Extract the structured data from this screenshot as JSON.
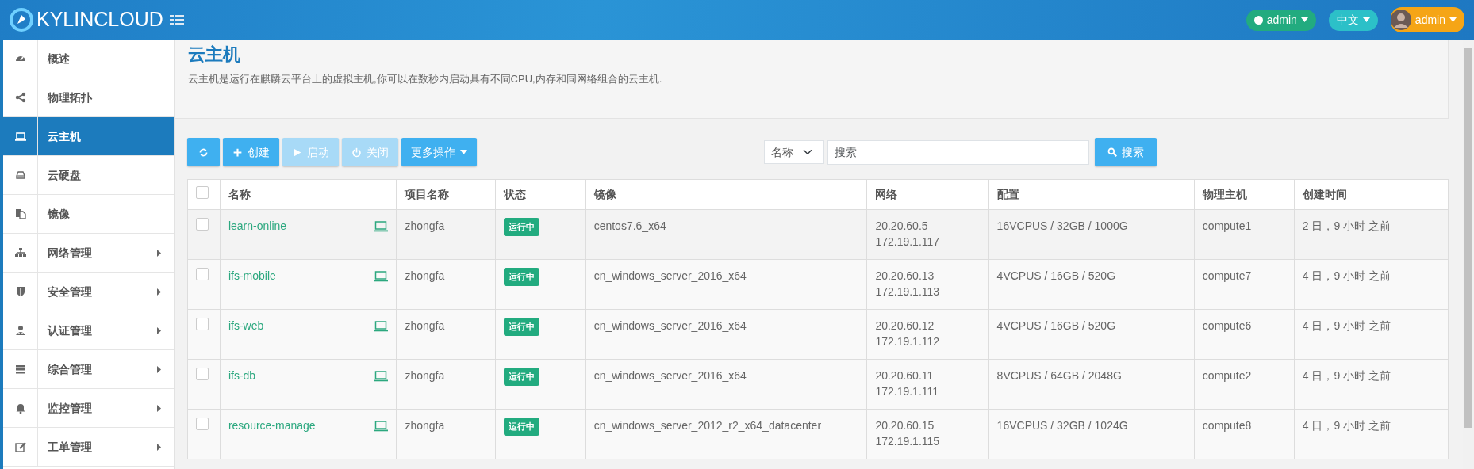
{
  "brand": {
    "title": "KYLINCLOUD"
  },
  "topbar": {
    "status_menu": "admin",
    "language_menu": "中文",
    "user_menu": "admin"
  },
  "sidebar": {
    "items": [
      {
        "label": "概述",
        "selected": false,
        "has_submenu": false
      },
      {
        "label": "物理拓扑",
        "selected": false,
        "has_submenu": false
      },
      {
        "label": "云主机",
        "selected": true,
        "has_submenu": false
      },
      {
        "label": "云硬盘",
        "selected": false,
        "has_submenu": false
      },
      {
        "label": "镜像",
        "selected": false,
        "has_submenu": false
      },
      {
        "label": "网络管理",
        "selected": false,
        "has_submenu": true
      },
      {
        "label": "安全管理",
        "selected": false,
        "has_submenu": true
      },
      {
        "label": "认证管理",
        "selected": false,
        "has_submenu": true
      },
      {
        "label": "综合管理",
        "selected": false,
        "has_submenu": true
      },
      {
        "label": "监控管理",
        "selected": false,
        "has_submenu": true
      },
      {
        "label": "工单管理",
        "selected": false,
        "has_submenu": true
      }
    ]
  },
  "header": {
    "title": "云主机",
    "description": "云主机是运行在麒麟云平台上的虚拟主机,你可以在数秒内启动具有不同CPU,内存和同网络组合的云主机."
  },
  "toolbar": {
    "buttons": [
      {
        "kind": "refresh",
        "disabled": false
      },
      {
        "kind": "create",
        "label": "创建",
        "disabled": false
      },
      {
        "kind": "start",
        "label": "启动",
        "disabled": true
      },
      {
        "kind": "stop",
        "label": "关闭",
        "disabled": true
      },
      {
        "kind": "more",
        "label": "更多操作",
        "disabled": false
      }
    ],
    "filter_select": "名称",
    "search_placeholder": "搜索",
    "search_button": "搜索"
  },
  "table": {
    "columns": [
      "名称",
      "项目名称",
      "状态",
      "镜像",
      "网络",
      "配置",
      "物理主机",
      "创建时间"
    ],
    "select_all_checked": false,
    "rows": [
      {
        "checked": false,
        "name": "learn-online",
        "project": "zhongfa",
        "status": "运行中",
        "image": "centos7.6_x64",
        "network": [
          "20.20.60.5",
          "172.19.1.117"
        ],
        "config": "16VCPUS / 32GB / 1000G",
        "host": "compute1",
        "created": "2 日，9 小时 之前"
      },
      {
        "checked": false,
        "name": "ifs-mobile",
        "project": "zhongfa",
        "status": "运行中",
        "image": "cn_windows_server_2016_x64",
        "network": [
          "20.20.60.13",
          "172.19.1.113"
        ],
        "config": "4VCPUS / 16GB / 520G",
        "host": "compute7",
        "created": "4 日，9 小时 之前"
      },
      {
        "checked": false,
        "name": "ifs-web",
        "project": "zhongfa",
        "status": "运行中",
        "image": "cn_windows_server_2016_x64",
        "network": [
          "20.20.60.12",
          "172.19.1.112"
        ],
        "config": "4VCPUS / 16GB / 520G",
        "host": "compute6",
        "created": "4 日，9 小时 之前"
      },
      {
        "checked": false,
        "name": "ifs-db",
        "project": "zhongfa",
        "status": "运行中",
        "image": "cn_windows_server_2016_x64",
        "network": [
          "20.20.60.11",
          "172.19.1.111"
        ],
        "config": "8VCPUS / 64GB / 2048G",
        "host": "compute2",
        "created": "4 日，9 小时 之前"
      },
      {
        "checked": false,
        "name": "resource-manage",
        "project": "zhongfa",
        "status": "运行中",
        "image": "cn_windows_server_2012_r2_x64_datacenter",
        "network": [
          "20.20.60.15",
          "172.19.1.115"
        ],
        "config": "16VCPUS / 32GB / 1024G",
        "host": "compute8",
        "created": "4 日，9 小时 之前"
      }
    ]
  }
}
